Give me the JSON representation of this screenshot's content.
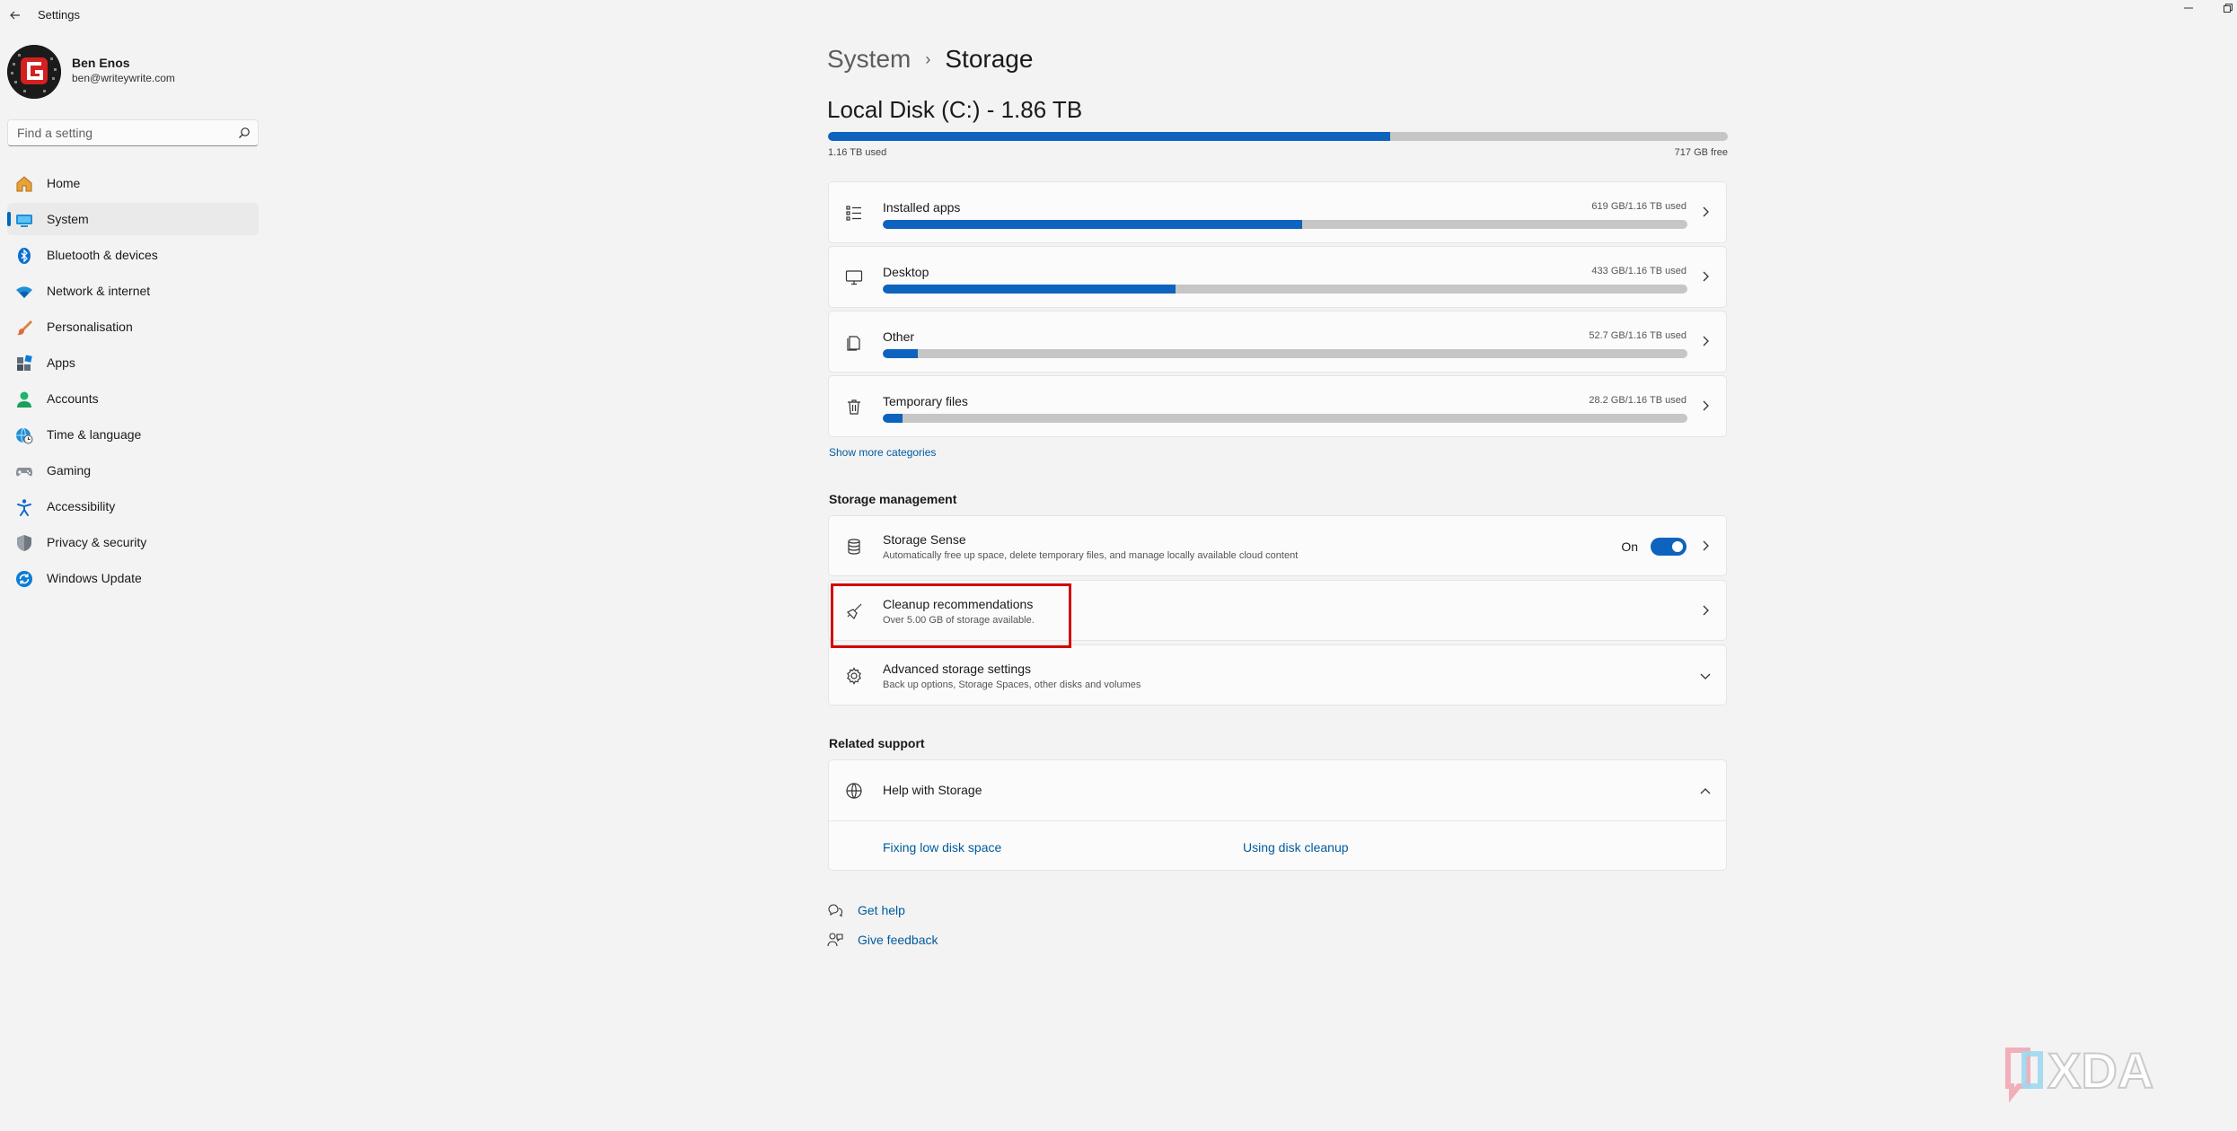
{
  "window": {
    "title": "Settings"
  },
  "user": {
    "name": "Ben Enos",
    "email": "ben@writeywrite.com"
  },
  "search": {
    "placeholder": "Find a setting"
  },
  "nav": [
    {
      "label": "Home",
      "icon": "home-icon",
      "active": false
    },
    {
      "label": "System",
      "icon": "system-icon",
      "active": true
    },
    {
      "label": "Bluetooth & devices",
      "icon": "bluetooth-icon",
      "active": false
    },
    {
      "label": "Network & internet",
      "icon": "wifi-icon",
      "active": false
    },
    {
      "label": "Personalisation",
      "icon": "brush-icon",
      "active": false
    },
    {
      "label": "Apps",
      "icon": "apps-icon",
      "active": false
    },
    {
      "label": "Accounts",
      "icon": "accounts-icon",
      "active": false
    },
    {
      "label": "Time & language",
      "icon": "globe-clock-icon",
      "active": false
    },
    {
      "label": "Gaming",
      "icon": "gamepad-icon",
      "active": false
    },
    {
      "label": "Accessibility",
      "icon": "accessibility-icon",
      "active": false
    },
    {
      "label": "Privacy & security",
      "icon": "shield-icon",
      "active": false
    },
    {
      "label": "Windows Update",
      "icon": "update-icon",
      "active": false
    }
  ],
  "breadcrumb": {
    "parent": "System",
    "separator": "›",
    "current": "Storage"
  },
  "disk": {
    "title": "Local Disk (C:) - 1.86 TB",
    "used_label": "1.16 TB used",
    "free_label": "717 GB free",
    "used_fraction": 0.625
  },
  "categories": [
    {
      "label": "Installed apps",
      "size": "619 GB/1.16 TB used",
      "fraction": 0.521,
      "icon": "list-icon"
    },
    {
      "label": "Desktop",
      "size": "433 GB/1.16 TB used",
      "fraction": 0.364,
      "icon": "monitor-icon"
    },
    {
      "label": "Other",
      "size": "52.7 GB/1.16 TB used",
      "fraction": 0.044,
      "icon": "other-files-icon"
    },
    {
      "label": "Temporary files",
      "size": "28.2 GB/1.16 TB used",
      "fraction": 0.024,
      "icon": "trash-icon"
    }
  ],
  "show_more": "Show more categories",
  "storage_management": {
    "heading": "Storage management",
    "items": [
      {
        "title": "Storage Sense",
        "desc": "Automatically free up space, delete temporary files, and manage locally available cloud content",
        "toggle_label": "On",
        "icon": "storage-sense-icon"
      },
      {
        "title": "Cleanup recommendations",
        "desc": "Over 5.00 GB of storage available.",
        "icon": "broom-icon"
      },
      {
        "title": "Advanced storage settings",
        "desc": "Back up options, Storage Spaces, other disks and volumes",
        "icon": "gear-icon"
      }
    ]
  },
  "related_support": {
    "heading": "Related support",
    "help_title": "Help with Storage",
    "links": [
      "Fixing low disk space",
      "Using disk cleanup"
    ]
  },
  "footer": {
    "get_help": "Get help",
    "give_feedback": "Give feedback"
  },
  "watermark": "XDA",
  "colors": {
    "accent": "#0d63bd",
    "bar_bg": "#c6c6c6",
    "highlight": "#d40000",
    "link": "#005a9e"
  }
}
